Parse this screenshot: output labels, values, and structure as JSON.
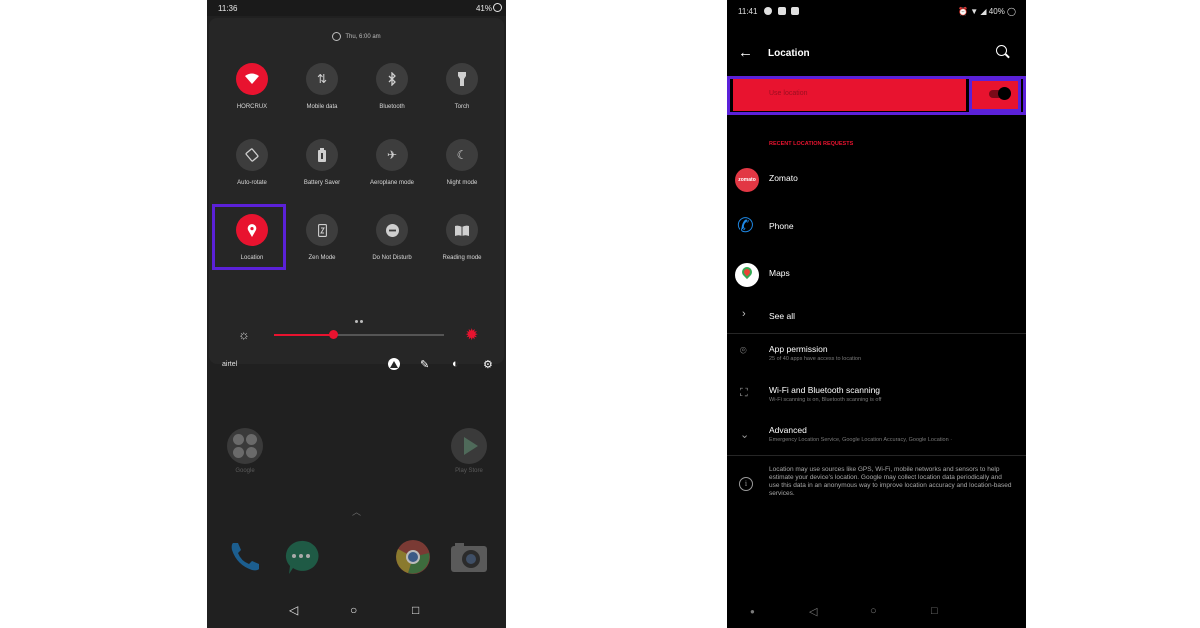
{
  "left_phone": {
    "status_bar": {
      "time": "11:36",
      "battery": "41%"
    },
    "alarm": "Thu, 6:00 am",
    "tiles": [
      {
        "label": "HORCRUX",
        "icon": "wifi-icon",
        "active": true
      },
      {
        "label": "Mobile data",
        "icon": "mobile-data-icon",
        "active": false
      },
      {
        "label": "Bluetooth",
        "icon": "bluetooth-icon",
        "active": false
      },
      {
        "label": "Torch",
        "icon": "torch-icon",
        "active": false
      },
      {
        "label": "Auto-rotate",
        "icon": "auto-rotate-icon",
        "active": false
      },
      {
        "label": "Battery Saver",
        "icon": "battery-saver-icon",
        "active": false
      },
      {
        "label": "Aeroplane mode",
        "icon": "aeroplane-icon",
        "active": false
      },
      {
        "label": "Night mode",
        "icon": "night-mode-icon",
        "active": false
      },
      {
        "label": "Location",
        "icon": "location-pin-icon",
        "active": true
      },
      {
        "label": "Zen Mode",
        "icon": "zen-mode-icon",
        "active": false
      },
      {
        "label": "Do Not Disturb",
        "icon": "do-not-disturb-icon",
        "active": false
      },
      {
        "label": "Reading mode",
        "icon": "reading-mode-icon",
        "active": false
      }
    ],
    "brightness": 0.35,
    "carrier": "airtel",
    "home": {
      "folder_label": "Google",
      "play_store_label": "Play Store"
    }
  },
  "right_phone": {
    "status_bar": {
      "time": "11:41",
      "battery": "40%"
    },
    "title": "Location",
    "use_location": {
      "label": "Use location",
      "enabled": true
    },
    "recent_header": "RECENT LOCATION REQUESTS",
    "recent_apps": [
      {
        "name": "Zomato",
        "icon": "zomato-icon",
        "badge": "zomato"
      },
      {
        "name": "Phone",
        "icon": "phone-icon"
      },
      {
        "name": "Maps",
        "icon": "maps-icon"
      }
    ],
    "see_all": "See all",
    "settings": [
      {
        "title": "App permission",
        "subtitle": "25 of 40 apps have access to location",
        "icon": "location-permission-icon"
      },
      {
        "title": "Wi-Fi and Bluetooth scanning",
        "subtitle": "Wi-Fi scanning is on, Bluetooth scanning is off",
        "icon": "scan-icon"
      },
      {
        "title": "Advanced",
        "subtitle": "Emergency Location Service, Google Location Accuracy, Google Location ·",
        "icon": "chevron-down-icon"
      }
    ],
    "info_text": "Location may use sources like GPS, Wi-Fi, mobile networks and sensors to help estimate your device's location. Google may collect location data periodically and use this data in an anonymous way to improve location accuracy and location-based services."
  },
  "colors": {
    "accent": "#e8132f",
    "highlight": "#5b21d9"
  }
}
